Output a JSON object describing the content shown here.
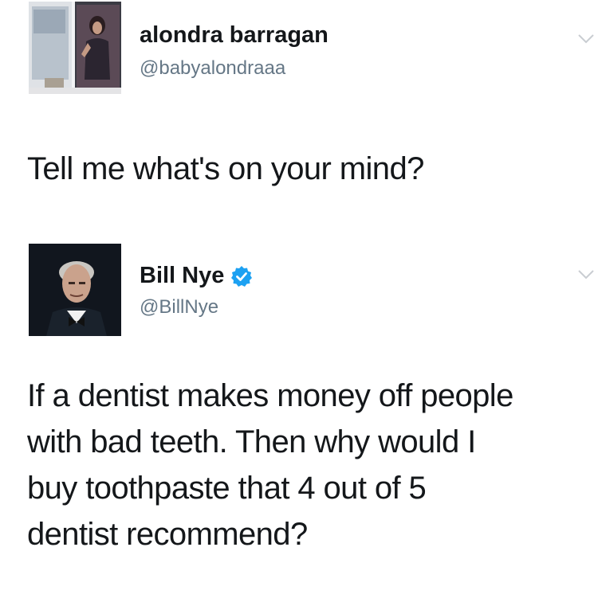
{
  "tweets": [
    {
      "display_name": "alondra barragan",
      "handle": "@babyalondraaa",
      "verified": false,
      "text_lines": [
        "Tell me what's on your mind?"
      ]
    },
    {
      "display_name": "Bill Nye",
      "handle": "@BillNye",
      "verified": true,
      "text_lines": [
        "If a dentist makes money off people",
        "with bad teeth. Then why would I",
        "buy toothpaste that 4 out of 5",
        "dentist recommend?"
      ]
    }
  ],
  "icons": {
    "verified": "verified-badge-icon",
    "menu": "chevron-down-icon"
  },
  "colors": {
    "text": "#14171a",
    "handle": "#657786",
    "verified": "#1da1f2",
    "background": "#ffffff"
  }
}
